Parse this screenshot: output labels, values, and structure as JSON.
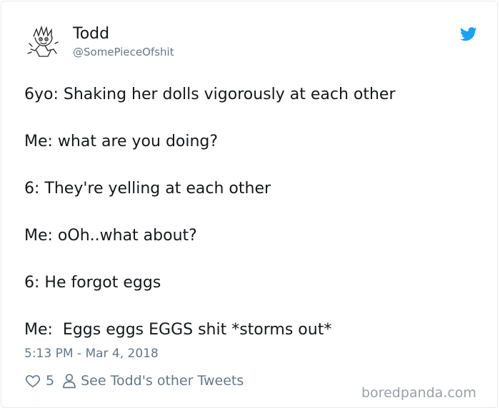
{
  "user": {
    "display_name": "Todd",
    "handle": "@SomePieceOfshit"
  },
  "tweet": {
    "lines": [
      "6yo: Shaking her dolls vigorously at each other",
      "Me: what are you doing?",
      "6: They're yelling at each other",
      "Me: oOh..what about?",
      "6: He forgot eggs",
      "Me:  Eggs eggs EGGS shit *storms out*"
    ],
    "timestamp": "5:13 PM - Mar 4, 2018"
  },
  "actions": {
    "like_count": "5",
    "other_tweets_label": "See Todd's other Tweets"
  },
  "watermark": "boredpanda.com",
  "icons": {
    "brand": "twitter-bird-icon",
    "like": "heart-icon",
    "profile": "person-icon"
  },
  "colors": {
    "twitter_blue": "#1da1f2",
    "text": "#14171a",
    "secondary": "#657786"
  }
}
